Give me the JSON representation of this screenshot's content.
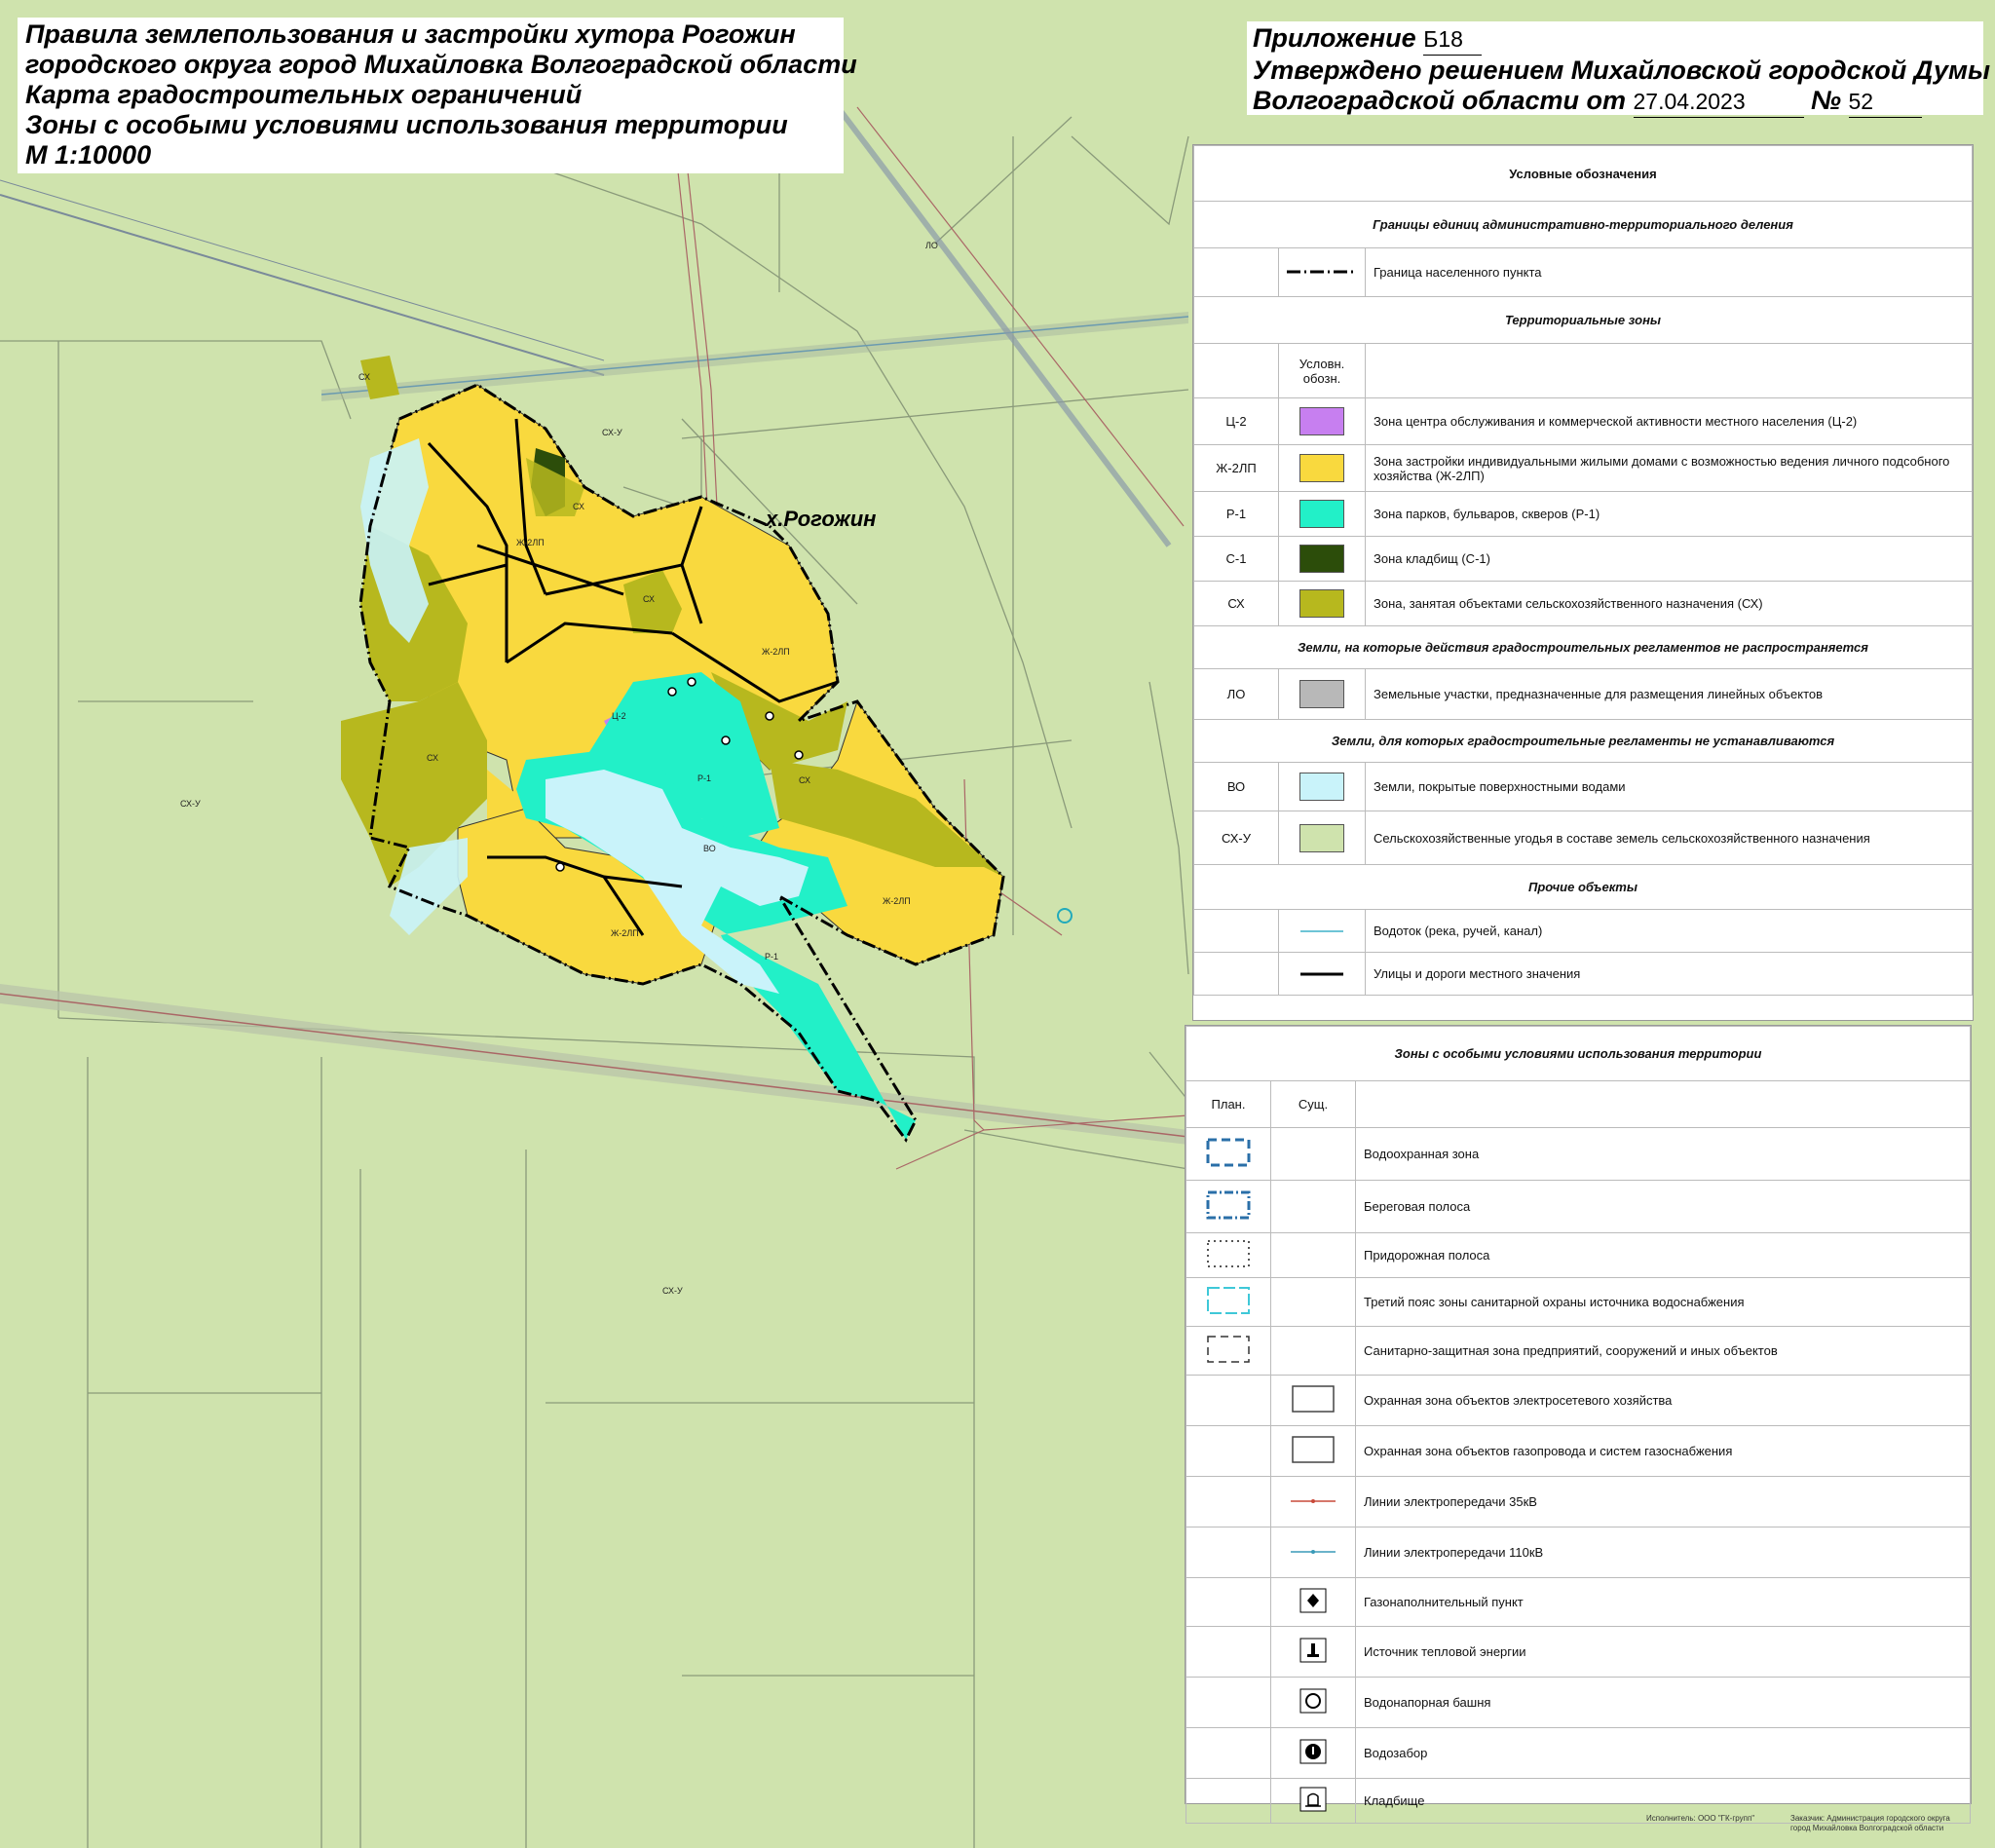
{
  "title": {
    "lines": [
      "Правила землепользования и застройки хутора Рогожин",
      "городского округа город Михайловка Волгоградской области",
      "Карта градостроительных ограничений",
      "Зоны с особыми условиями использования территории",
      "М 1:10000"
    ]
  },
  "approval": {
    "line1_label": "Приложение",
    "line1_value": "Б18",
    "line2": "Утверждено решением Михайловской городской Думы",
    "line3_label": "Волгоградской области от",
    "date": "27.04.2023",
    "number_label": "№",
    "number": "52"
  },
  "map": {
    "settlement_label": "х.Рогожин",
    "zone_labels": [
      "СХ",
      "СХ-У",
      "СХ",
      "Ж-2ЛП",
      "СХ",
      "Ж-2ЛП",
      "Ц-2",
      "Р-1",
      "СХ",
      "СХ",
      "СХ-У",
      "ВО",
      "Ж-2ЛП",
      "Ж-2ЛП",
      "Р-1",
      "СХ-У",
      "ЛО"
    ],
    "colors": {
      "background_agri": "#cfe3ad",
      "residential": "#f9d93e",
      "agricultural": "#b7b81e",
      "park": "#22f0c8",
      "water": "#c9f3fa",
      "center": "#c77ff0",
      "cemetery": "#2c4d0a",
      "linear_objects": "#b8b8b8"
    }
  },
  "legend_main": {
    "header": "Условные обозначения",
    "section_admin": "Границы единиц административно-территориального деления",
    "admin_item": "Граница населенного пункта",
    "section_zones": "Территориальные зоны",
    "col_symbol": "Условн. обозн.",
    "zones": [
      {
        "code": "Ц-2",
        "label": "Зона центра обслуживания и коммерческой активности местного населения (Ц-2)",
        "color": "#c77ff0"
      },
      {
        "code": "Ж-2ЛП",
        "label": "Зона застройки индивидуальными жилыми домами с возможностью ведения личного подсобного хозяйства (Ж-2ЛП)",
        "color": "#f9d93e"
      },
      {
        "code": "Р-1",
        "label": "Зона парков, бульваров, скверов (Р-1)",
        "color": "#22f0c8"
      },
      {
        "code": "С-1",
        "label": "Зона кладбищ (С-1)",
        "color": "#2c4d0a"
      },
      {
        "code": "СХ",
        "label": "Зона, занятая объектами сельскохозяйственного назначения (СХ)",
        "color": "#b7b81e"
      }
    ],
    "section_not_applied": "Земли, на которые действия градостроительных регламентов не распространяется",
    "not_applied": [
      {
        "code": "ЛО",
        "label": "Земельные участки, предназначенные для размещения линейных объектов",
        "color": "#b8b8b8"
      }
    ],
    "section_not_set": "Земли, для которых градостроительные регламенты не устанавливаются",
    "not_set": [
      {
        "code": "ВО",
        "label": "Земли, покрытые поверхностными водами",
        "color": "#c9f3fa"
      },
      {
        "code": "СХ-У",
        "label": "Сельскохозяйственные угодья в составе земель сельскохозяйственного назначения",
        "color": "#cfe3ad"
      }
    ],
    "section_other": "Прочие объекты",
    "other": [
      {
        "label": "Водоток (река, ручей, канал)",
        "icon": "watercourse-line"
      },
      {
        "label": "Улицы и дороги местного значения",
        "icon": "road-line"
      }
    ]
  },
  "legend_zouit": {
    "header": "Зоны с особыми условиями использования территории",
    "col_plan": "План.",
    "col_exist": "Сущ.",
    "items": [
      {
        "label": "Водоохранная зона",
        "icon": "water-protection-zone"
      },
      {
        "label": "Береговая полоса",
        "icon": "shoreline-strip"
      },
      {
        "label": "Придорожная полоса",
        "icon": "roadside-strip"
      },
      {
        "label": "Третий пояс зоны санитарной охраны источника водоснабжения",
        "icon": "sanitary-belt"
      },
      {
        "label": "Санитарно-защитная зона предприятий, сооружений и иных объектов",
        "icon": "sanitary-protection-zone"
      },
      {
        "label": "Охранная зона объектов электросетевого хозяйства",
        "icon": "power-grid-zone"
      },
      {
        "label": "Охранная зона объектов газопровода и систем газоснабжения",
        "icon": "gas-zone"
      },
      {
        "label": "Линии электропередачи 35кВ",
        "icon": "power-line-35"
      },
      {
        "label": "Линии электропередачи 110кВ",
        "icon": "power-line-110"
      },
      {
        "label": "Газонаполнительный пункт",
        "icon": "gas-filling-icon"
      },
      {
        "label": "Источник тепловой энергии",
        "icon": "heat-source-icon"
      },
      {
        "label": "Водонапорная башня",
        "icon": "water-tower-icon"
      },
      {
        "label": "Водозабор",
        "icon": "water-intake-icon"
      },
      {
        "label": "Кладбище",
        "icon": "cemetery-icon"
      }
    ]
  },
  "credits": {
    "executor": "Исполнитель: ООО \"ГК-групп\"",
    "customer_line1": "Заказчик: Администрация городского округа",
    "customer_line2": "город Михайловка Волгоградской области"
  }
}
